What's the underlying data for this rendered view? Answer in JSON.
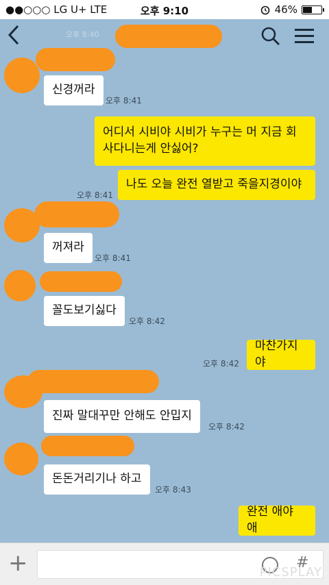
{
  "status": {
    "carrier": "●●○○○ LG U+  LTE",
    "time": "오후 9:10",
    "battery": "46%",
    "battery_level": 0.46,
    "alarm_icon": "alarm-icon"
  },
  "header": {
    "faded_text": "오후 8:40",
    "back_icon": "chevron-left-icon",
    "search_icon": "search-icon",
    "menu_icon": "menu-icon"
  },
  "messages": [
    {
      "side": "left",
      "text": "신경꺼라",
      "time": "오후 8:41"
    },
    {
      "side": "right",
      "text": "어디서 시비야 시비가  누구는 머 지금 회사다니는게 안싫어?"
    },
    {
      "side": "right",
      "text": "나도 오늘 완전 열받고 죽을지경이야",
      "time": "오후 8:41"
    },
    {
      "side": "left",
      "text": "꺼져라",
      "time": "오후 8:41"
    },
    {
      "side": "left",
      "text": "꼴도보기싫다",
      "time": "오후 8:42"
    },
    {
      "side": "right",
      "text": "마찬가지야",
      "time": "오후 8:42"
    },
    {
      "side": "left",
      "text": "진짜 말대꾸만 안해도 안밉지",
      "time": "오후 8:42"
    },
    {
      "side": "left",
      "text": "돈돈거리기나 하고",
      "time": "오후 8:43"
    },
    {
      "side": "right",
      "text": "완전 애야 애"
    }
  ],
  "input": {
    "plus": "+",
    "hash": "#",
    "watermark": "PICSPLAY"
  }
}
